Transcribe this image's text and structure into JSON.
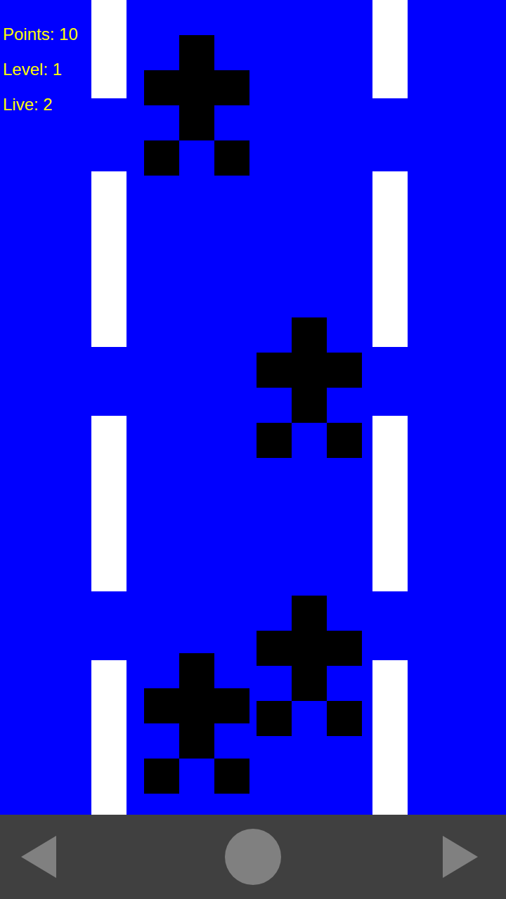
{
  "hud": [
    {
      "text": "Points: 10"
    },
    {
      "text": "Level: 1"
    },
    {
      "text": "Live: 2"
    }
  ],
  "cars": [
    {
      "lane": "left"
    },
    {
      "lane": "right"
    },
    {
      "lane": "right"
    },
    {
      "lane": "left"
    }
  ]
}
